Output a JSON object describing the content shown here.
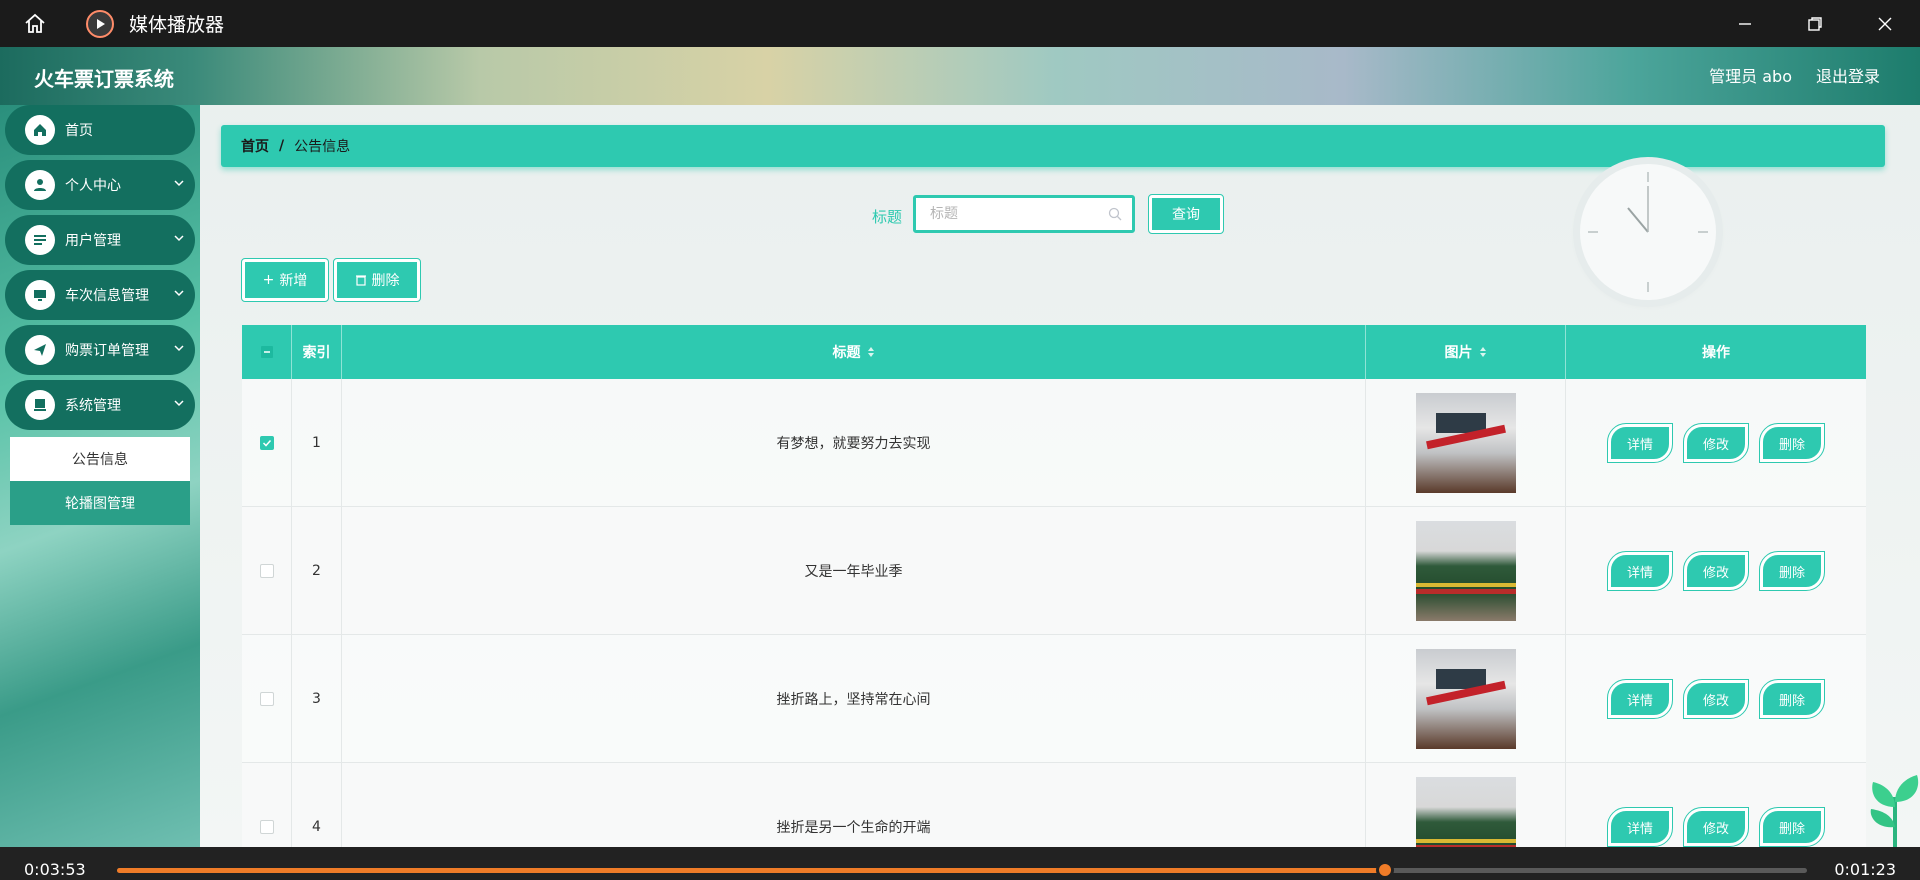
{
  "player": {
    "title": "媒体播放器",
    "time_elapsed": "0:03:53",
    "time_remaining": "0:01:23",
    "progress_fraction": 0.75
  },
  "app": {
    "title": "火车票订票系统",
    "user_label": "管理员 abo",
    "logout_label": "退出登录"
  },
  "sidebar": {
    "items": [
      {
        "label": "首页"
      },
      {
        "label": "个人中心"
      },
      {
        "label": "用户管理"
      },
      {
        "label": "车次信息管理"
      },
      {
        "label": "购票订单管理"
      },
      {
        "label": "系统管理"
      }
    ],
    "subitems": [
      {
        "label": "公告信息"
      },
      {
        "label": "轮播图管理"
      }
    ]
  },
  "breadcrumb": {
    "home": "首页",
    "separator": "/",
    "current": "公告信息"
  },
  "search": {
    "label": "标题",
    "placeholder": "标题",
    "value": "",
    "query_button": "查询"
  },
  "actions": {
    "add": "新增",
    "delete": "删除"
  },
  "table": {
    "columns": {
      "index": "索引",
      "title": "标题",
      "image": "图片",
      "operations": "操作"
    },
    "row_buttons": {
      "detail": "详情",
      "edit": "修改",
      "delete": "删除"
    },
    "rows": [
      {
        "index": "1",
        "title": "有梦想，就要努力去实现",
        "checked": true
      },
      {
        "index": "2",
        "title": "又是一年毕业季",
        "checked": false
      },
      {
        "index": "3",
        "title": "挫折路上，坚持常在心间",
        "checked": false
      },
      {
        "index": "4",
        "title": "挫折是另一个生命的开端",
        "checked": false
      }
    ]
  },
  "colors": {
    "accent": "#2ec9b0",
    "sidebar_item": "#136f5f",
    "progress": "#f07c28"
  }
}
